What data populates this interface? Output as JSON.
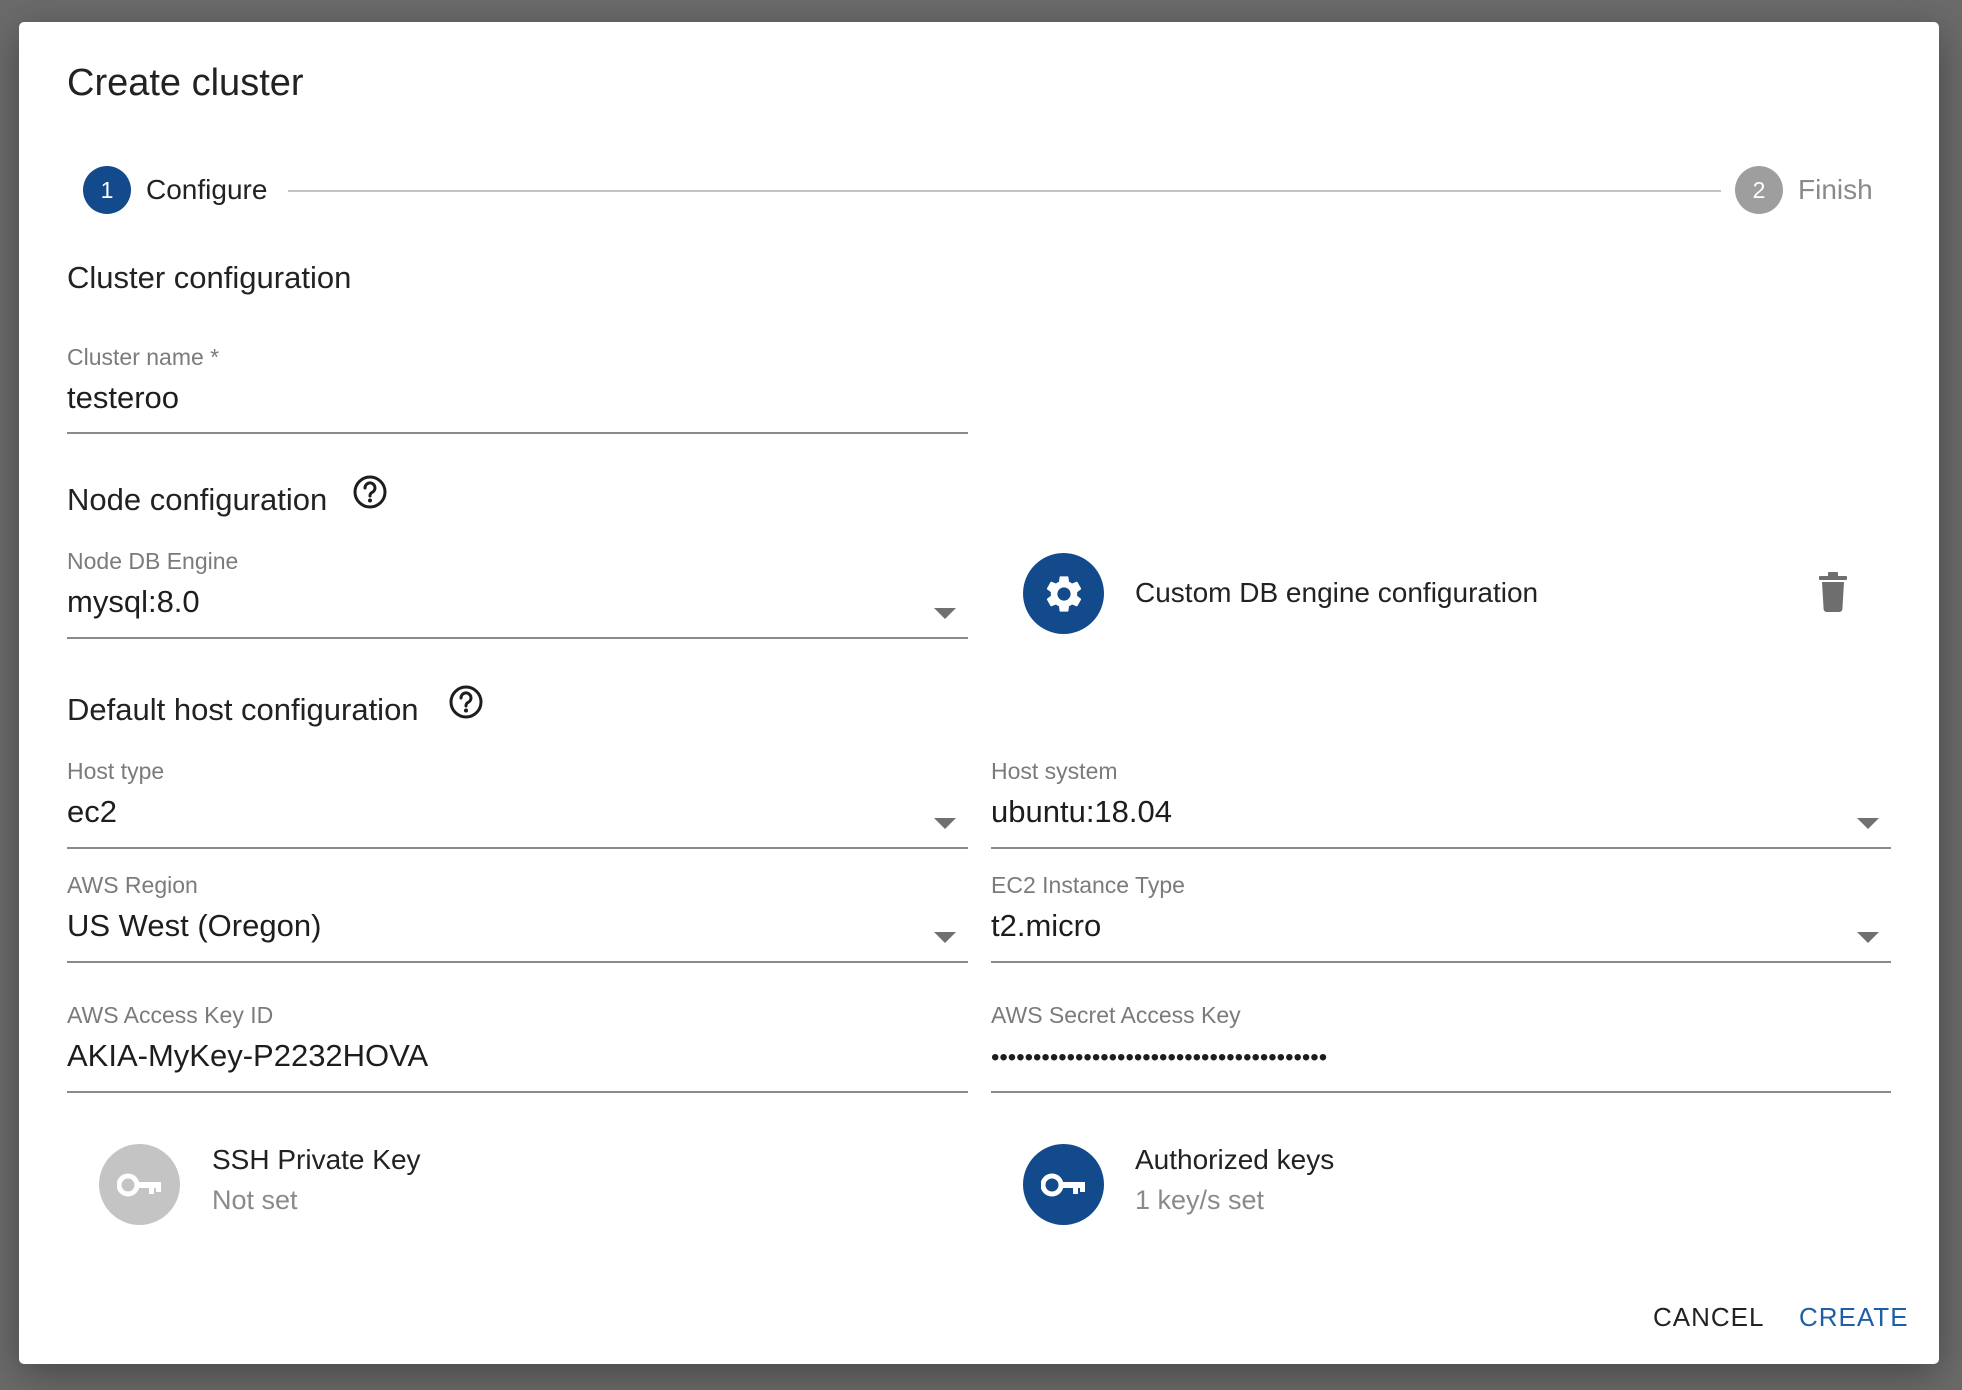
{
  "dialog": {
    "title": "Create cluster"
  },
  "stepper": {
    "steps": [
      {
        "number": "1",
        "label": "Configure",
        "state": "active"
      },
      {
        "number": "2",
        "label": "Finish",
        "state": "inactive"
      }
    ]
  },
  "cluster_config": {
    "heading": "Cluster configuration",
    "cluster_name": {
      "label": "Cluster name *",
      "value": "testeroo"
    }
  },
  "node_config": {
    "heading": "Node configuration",
    "help_icon": "help-circle-icon",
    "db_engine": {
      "label": "Node DB Engine",
      "value": "mysql:8.0"
    },
    "custom_engine": {
      "label": "Custom DB engine configuration",
      "icon": "gear-icon",
      "delete_icon": "trash-icon"
    }
  },
  "host_config": {
    "heading": "Default host configuration",
    "help_icon": "help-circle-icon",
    "host_type": {
      "label": "Host type",
      "value": "ec2"
    },
    "host_system": {
      "label": "Host system",
      "value": "ubuntu:18.04"
    },
    "aws_region": {
      "label": "AWS Region",
      "value": "US West (Oregon)"
    },
    "ec2_instance_type": {
      "label": "EC2 Instance Type",
      "value": "t2.micro"
    },
    "aws_access_key_id": {
      "label": "AWS Access Key ID",
      "value": "AKIA-MyKey-P2232HOVA"
    },
    "aws_secret_access_key": {
      "label": "AWS Secret Access Key",
      "value": "••••••••••••••••••••••••••••••••••••••••"
    }
  },
  "keys": {
    "ssh_private_key": {
      "title": "SSH Private Key",
      "status": "Not set",
      "icon": "key-icon"
    },
    "authorized_keys": {
      "title": "Authorized keys",
      "status": "1 key/s set",
      "icon": "key-icon"
    }
  },
  "actions": {
    "cancel": "CANCEL",
    "create": "CREATE"
  },
  "colors": {
    "primary": "#124a8b",
    "accent_text": "#1f5fa6",
    "inactive": "#9e9e9e",
    "disabled_avatar": "#c4c4c4"
  }
}
